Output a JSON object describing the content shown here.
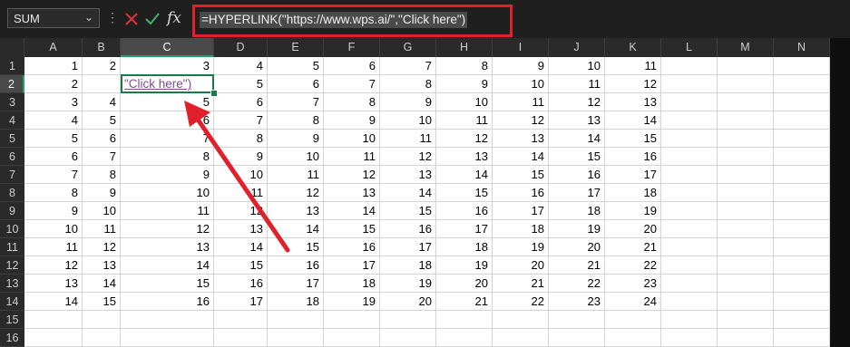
{
  "namebox": {
    "value": "SUM"
  },
  "formula_bar": {
    "formula": "=HYPERLINK(\"https://www.wps.ai/\",\"Click here\")",
    "fx_label": "fx"
  },
  "columns": [
    "A",
    "B",
    "C",
    "D",
    "E",
    "F",
    "G",
    "H",
    "I",
    "J",
    "K",
    "L",
    "M",
    "N"
  ],
  "selected_column": "C",
  "rows": [
    "1",
    "2",
    "3",
    "4",
    "5",
    "6",
    "7",
    "8",
    "9",
    "10",
    "11",
    "12",
    "13",
    "14",
    "15",
    "16"
  ],
  "selected_row": "2",
  "cells": [
    [
      "1",
      "2",
      "3",
      "4",
      "5",
      "6",
      "7",
      "8",
      "9",
      "10",
      "11"
    ],
    [
      "2",
      "",
      "\"Click here\")",
      "5",
      "6",
      "7",
      "8",
      "9",
      "10",
      "11",
      "12"
    ],
    [
      "3",
      "4",
      "5",
      "6",
      "7",
      "8",
      "9",
      "10",
      "11",
      "12",
      "13"
    ],
    [
      "4",
      "5",
      "6",
      "7",
      "8",
      "9",
      "10",
      "11",
      "12",
      "13",
      "14"
    ],
    [
      "5",
      "6",
      "7",
      "8",
      "9",
      "10",
      "11",
      "12",
      "13",
      "14",
      "15"
    ],
    [
      "6",
      "7",
      "8",
      "9",
      "10",
      "11",
      "12",
      "13",
      "14",
      "15",
      "16"
    ],
    [
      "7",
      "8",
      "9",
      "10",
      "11",
      "12",
      "13",
      "14",
      "15",
      "16",
      "17"
    ],
    [
      "8",
      "9",
      "10",
      "11",
      "12",
      "13",
      "14",
      "15",
      "16",
      "17",
      "18"
    ],
    [
      "9",
      "10",
      "11",
      "12",
      "13",
      "14",
      "15",
      "16",
      "17",
      "18",
      "19"
    ],
    [
      "10",
      "11",
      "12",
      "13",
      "14",
      "15",
      "16",
      "17",
      "18",
      "19",
      "20"
    ],
    [
      "11",
      "12",
      "13",
      "14",
      "15",
      "16",
      "17",
      "18",
      "19",
      "20",
      "21"
    ],
    [
      "12",
      "13",
      "14",
      "15",
      "16",
      "17",
      "18",
      "19",
      "20",
      "21",
      "22"
    ],
    [
      "13",
      "14",
      "15",
      "16",
      "17",
      "18",
      "19",
      "20",
      "21",
      "22",
      "23"
    ],
    [
      "14",
      "15",
      "16",
      "17",
      "18",
      "19",
      "20",
      "21",
      "22",
      "23",
      "24"
    ]
  ],
  "active_cell": "C2",
  "colors": {
    "accent": "#e0202a",
    "selection": "#1a7a45",
    "link": "#7d4e8d"
  },
  "icons": {
    "cancel": "x-icon",
    "enter": "check-icon",
    "function": "fx-icon"
  }
}
